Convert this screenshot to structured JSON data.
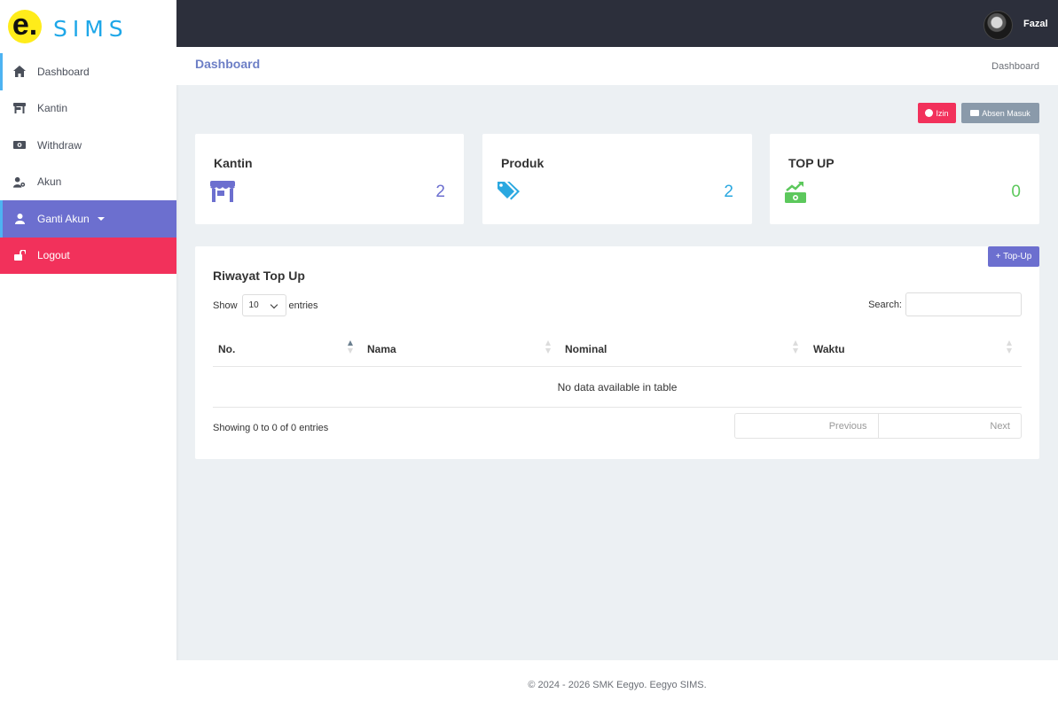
{
  "brand": {
    "logo_letter": "e.",
    "name": "SIMS"
  },
  "sidebar": {
    "items": [
      {
        "label": "Dashboard",
        "icon": "home-icon"
      },
      {
        "label": "Kantin",
        "icon": "store-icon"
      },
      {
        "label": "Withdraw",
        "icon": "money-icon"
      },
      {
        "label": "Akun",
        "icon": "user-gear-icon"
      },
      {
        "label": "Ganti Akun",
        "icon": "user-icon"
      },
      {
        "label": "Logout",
        "icon": "unlock-icon"
      }
    ]
  },
  "topbar": {
    "username": "Fazal"
  },
  "header": {
    "title": "Dashboard",
    "breadcrumb": "Dashboard"
  },
  "actions": {
    "izin_label": "Izin",
    "absen_label": "Absen Masuk"
  },
  "cards": [
    {
      "title": "Kantin",
      "value": "2",
      "icon": "store-icon",
      "color": "#6c6fcf"
    },
    {
      "title": "Produk",
      "value": "2",
      "icon": "tags-icon",
      "color": "#2aa8e0"
    },
    {
      "title": "TOP UP",
      "value": "0",
      "icon": "money-trend-icon",
      "color": "#5cc85c"
    }
  ],
  "table": {
    "title": "Riwayat Top Up",
    "topup_button": "+ Top-Up",
    "show_label": "Show",
    "entries_value": "10",
    "entries_label": "entries",
    "search_label": "Search:",
    "columns": [
      "No.",
      "Nama",
      "Nominal",
      "Waktu"
    ],
    "empty_text": "No data available in table",
    "info": "Showing 0 to 0 of 0 entries",
    "prev_label": "Previous",
    "next_label": "Next"
  },
  "footer": {
    "text": "© 2024 - 2026 SMK Eegyo. Eegyo SIMS."
  }
}
